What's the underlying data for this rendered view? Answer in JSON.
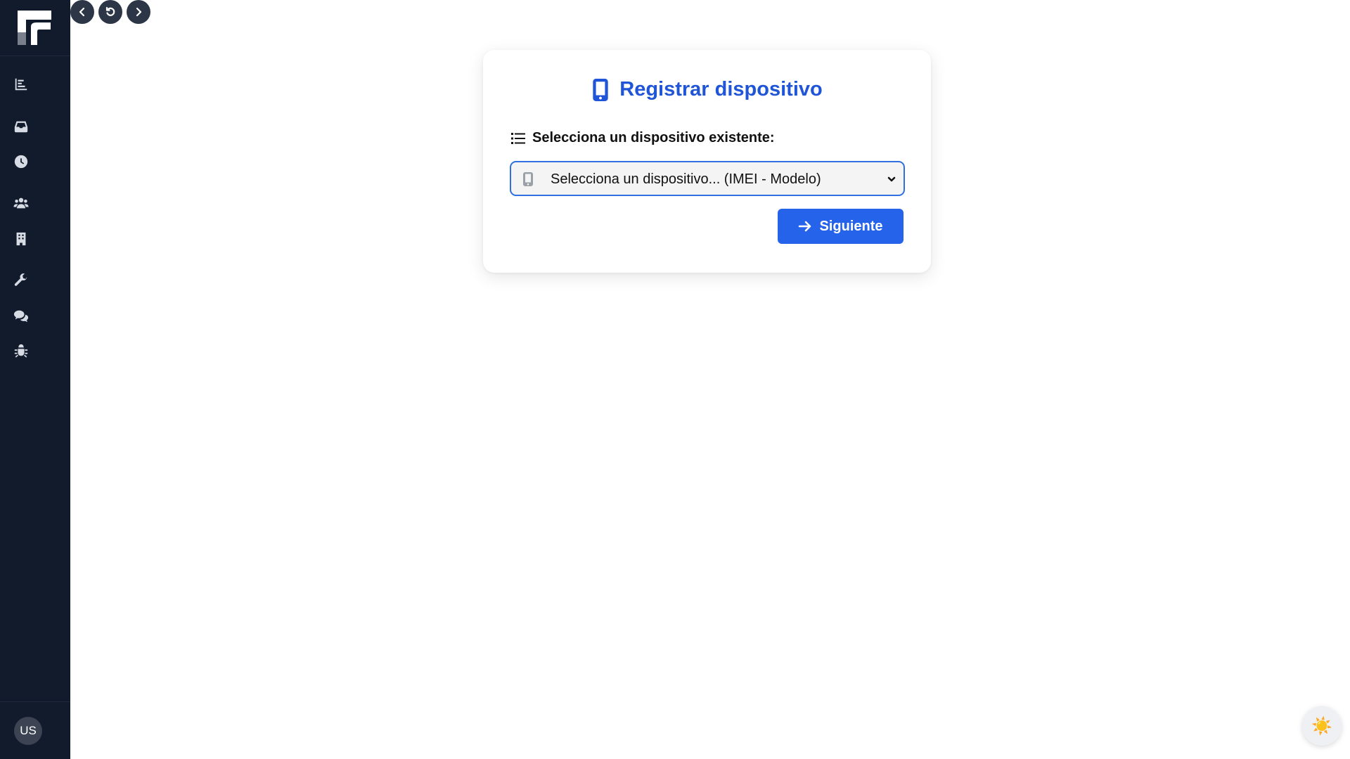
{
  "sidebar": {
    "items": [
      {
        "icon": "chart-bar-icon",
        "name": "sidebar-item-dashboard"
      },
      {
        "icon": "inbox-icon",
        "name": "sidebar-item-inbox"
      },
      {
        "icon": "clock-icon",
        "name": "sidebar-item-history"
      },
      {
        "icon": "users-icon",
        "name": "sidebar-item-users"
      },
      {
        "icon": "building-icon",
        "name": "sidebar-item-buildings"
      },
      {
        "icon": "wrench-icon",
        "name": "sidebar-item-tools"
      },
      {
        "icon": "comments-icon",
        "name": "sidebar-item-messages"
      },
      {
        "icon": "bug-icon",
        "name": "sidebar-item-bugs"
      }
    ],
    "avatar_text": "US"
  },
  "card": {
    "title": "Registrar dispositivo",
    "field_label": "Selecciona un dispositivo existente:",
    "select_value": "Selecciona un dispositivo... (IMEI - Modelo)",
    "next_button": "Siguiente"
  },
  "theme_toggle_glyph": "☀️",
  "colors": {
    "sidebar_bg": "#121b2c",
    "accent": "#1f55d6",
    "button": "#2563eb"
  }
}
